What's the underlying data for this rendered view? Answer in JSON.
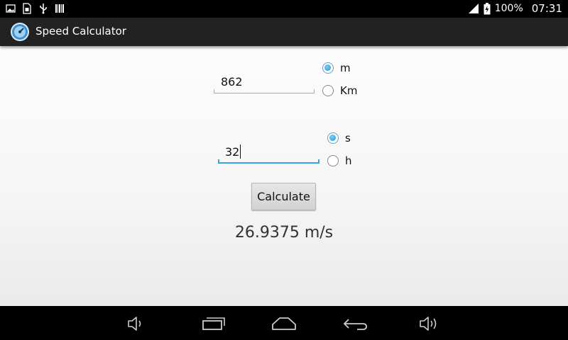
{
  "status_bar": {
    "battery": "100%",
    "time": "07:31",
    "icons": [
      "image-icon",
      "sd-card-icon",
      "usb-icon",
      "barcode-icon",
      "signal-icon",
      "battery-icon"
    ]
  },
  "action_bar": {
    "app_icon": "app-logo-icon",
    "title": "Speed Calculator"
  },
  "form": {
    "distance_value": "862",
    "distance_units": [
      {
        "label": "m",
        "selected": true
      },
      {
        "label": "Km",
        "selected": false
      }
    ],
    "time_value": "32",
    "time_units": [
      {
        "label": "s",
        "selected": true
      },
      {
        "label": "h",
        "selected": false
      }
    ],
    "calculate_label": "Calculate",
    "result": "26.9375 m/s"
  },
  "nav_bar": {
    "buttons": [
      "volume-down-icon",
      "recent-apps-icon",
      "home-icon",
      "back-icon",
      "volume-up-icon"
    ]
  },
  "colors": {
    "accent": "#33a8d8",
    "action_bar": "#222222",
    "system_bars": "#000000"
  }
}
